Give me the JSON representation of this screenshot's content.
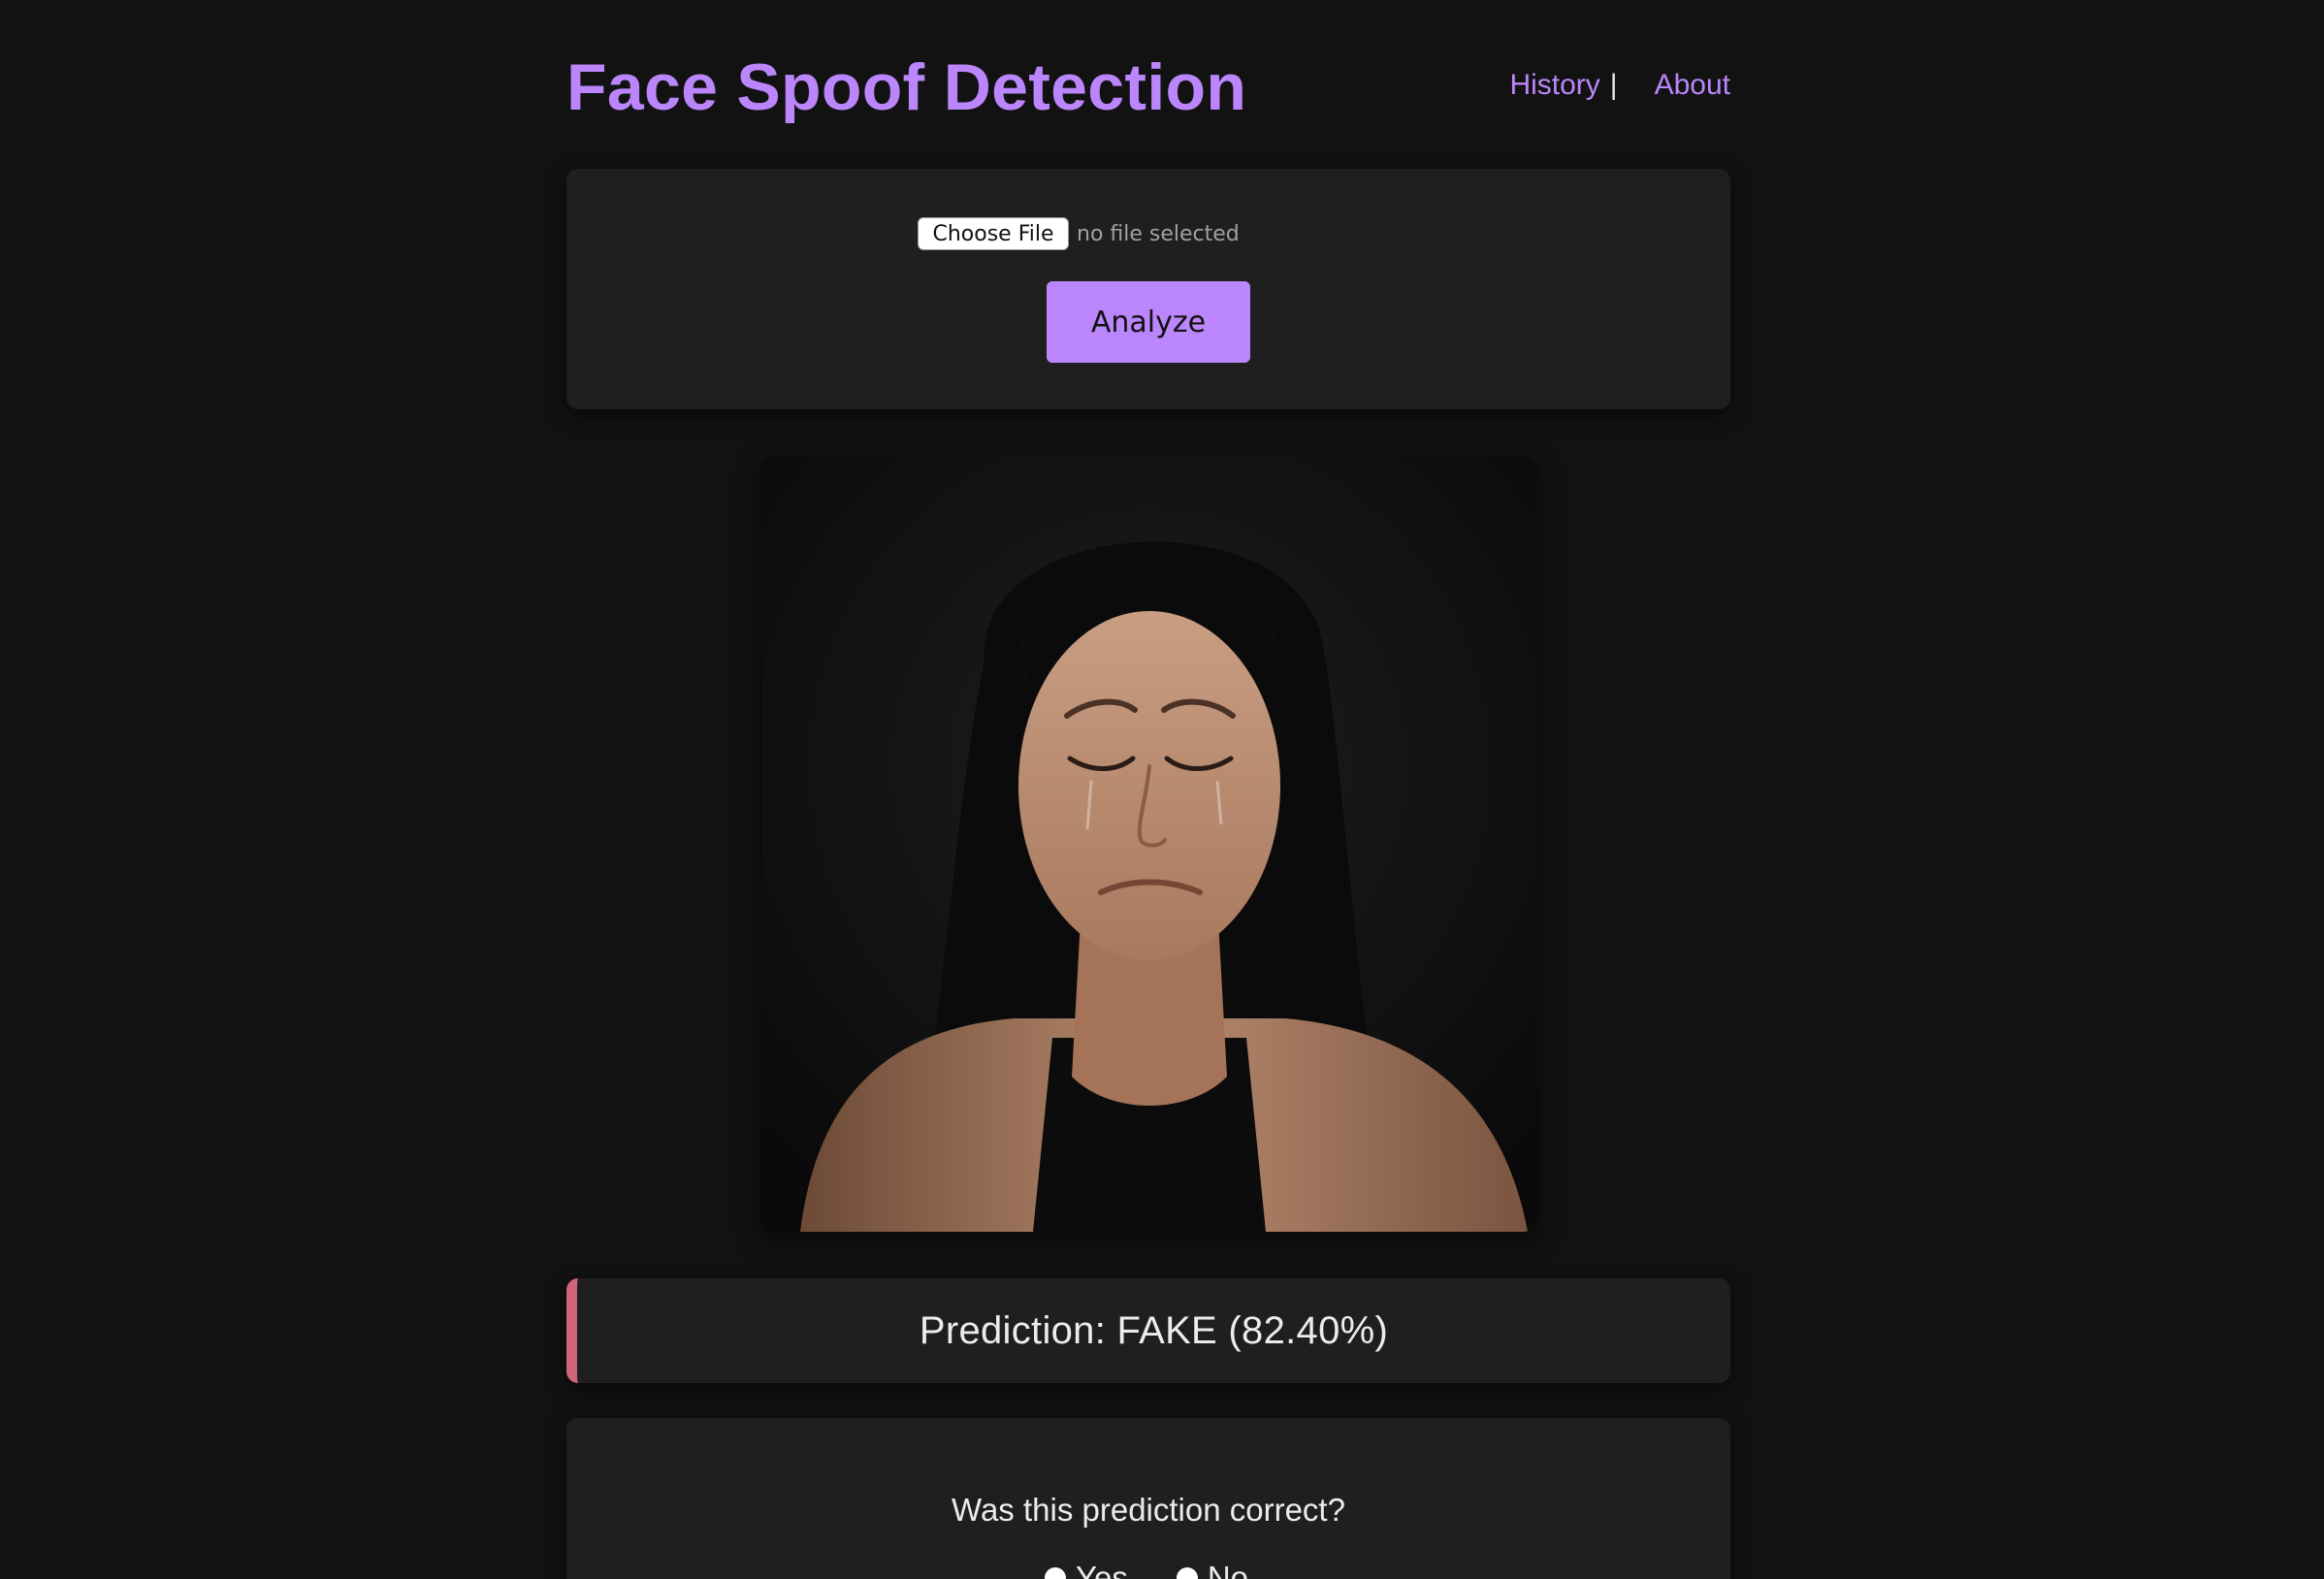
{
  "header": {
    "title": "Face Spoof Detection",
    "nav": {
      "history": "History",
      "separator": "|",
      "about": "About"
    }
  },
  "upload": {
    "choose_file_label": "Choose File",
    "file_status": "no file selected",
    "analyze_label": "Analyze"
  },
  "result": {
    "prediction_text": "Prediction: FAKE (82.40%)",
    "status_color": "#cf6679"
  },
  "feedback": {
    "question": "Was this prediction correct?",
    "options": [
      "Yes",
      "No"
    ]
  },
  "theme": {
    "accent": "#bb86fc",
    "background": "#121212",
    "card": "#1f1f1f"
  }
}
